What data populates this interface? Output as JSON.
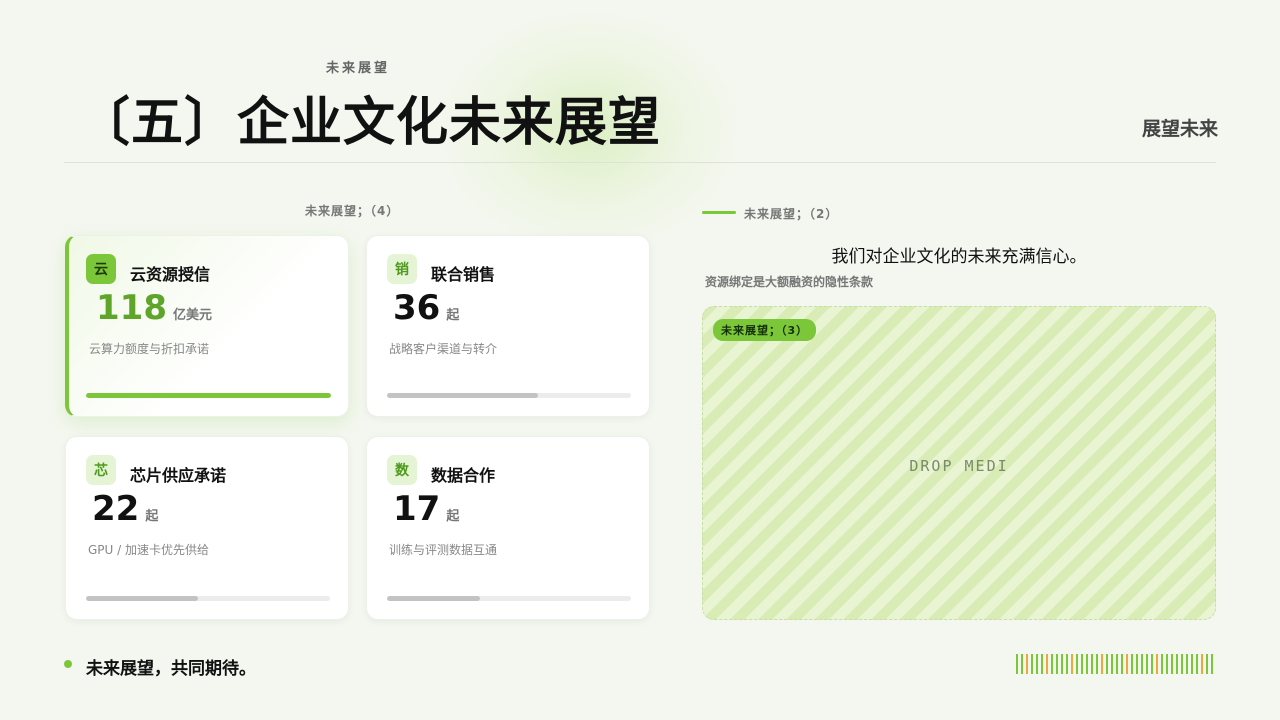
{
  "header": {
    "eyebrow": "未来展望",
    "title": "〔五〕企业文化未来展望",
    "right_label": "展望未来"
  },
  "left_section": {
    "caption": "未来展望；（4）",
    "cards": [
      {
        "icon_char": "云",
        "icon": "cloud-badge-icon",
        "title": "云资源授信",
        "value": "118",
        "unit": "亿美元",
        "desc": "云算力额度与折扣承诺",
        "progress": 1.0,
        "featured": true
      },
      {
        "icon_char": "销",
        "icon": "sales-badge-icon",
        "title": "联合销售",
        "value": "36",
        "unit": "起",
        "desc": "战略客户渠道与转介",
        "progress": 0.62
      },
      {
        "icon_char": "芯",
        "icon": "chip-badge-icon",
        "title": "芯片供应承诺",
        "value": "22",
        "unit": "起",
        "desc": "GPU /  加速卡优先供给",
        "progress": 0.46
      },
      {
        "icon_char": "数",
        "icon": "data-badge-icon",
        "title": "数据合作",
        "value": "17",
        "unit": "起",
        "desc": "训练与评测数据互通",
        "progress": 0.38
      }
    ]
  },
  "right_section": {
    "caption": "未来展望；（2）",
    "quote": "我们对企业文化的未来充满信心。",
    "note": "资源绑定是大额融资的隐性条款",
    "dropzone": {
      "tag": "未来展望；（3）",
      "label": "DROP MEDI"
    }
  },
  "footer": {
    "text": "未来展望，共同期待。"
  },
  "colors": {
    "accent": "#7cc63a",
    "accent_dark": "#5fa52a",
    "barcode": [
      "#7cc63a",
      "#7cc63a",
      "#f0a63a",
      "#7cc63a",
      "#7cc63a",
      "#7cc63a",
      "#f0a63a",
      "#7cc63a",
      "#7cc63a",
      "#7cc63a",
      "#7cc63a",
      "#f0a63a",
      "#7cc63a",
      "#7cc63a",
      "#7cc63a",
      "#7cc63a",
      "#7cc63a",
      "#f0a63a",
      "#7cc63a",
      "#7cc63a",
      "#7cc63a",
      "#7cc63a",
      "#f0a63a",
      "#7cc63a",
      "#7cc63a",
      "#7cc63a",
      "#7cc63a",
      "#7cc63a",
      "#f0a63a",
      "#7cc63a",
      "#7cc63a",
      "#7cc63a",
      "#7cc63a",
      "#7cc63a",
      "#7cc63a",
      "#7cc63a",
      "#7cc63a",
      "#f0a63a",
      "#7cc63a",
      "#7cc63a"
    ]
  }
}
